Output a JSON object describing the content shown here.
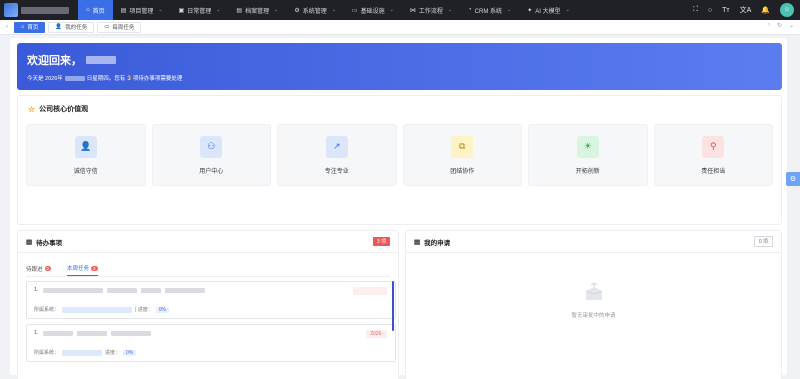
{
  "nav": {
    "items": [
      {
        "label": "首页",
        "icon": "⌂",
        "active": true,
        "has_menu": false
      },
      {
        "label": "项目管理",
        "icon": "▤",
        "active": false,
        "has_menu": true
      },
      {
        "label": "日常管理",
        "icon": "▣",
        "active": false,
        "has_menu": true
      },
      {
        "label": "档案管理",
        "icon": "▤",
        "active": false,
        "has_menu": true
      },
      {
        "label": "系统管理",
        "icon": "⚙",
        "active": false,
        "has_menu": true
      },
      {
        "label": "基础设施",
        "icon": "▭",
        "active": false,
        "has_menu": true
      },
      {
        "label": "工作流程",
        "icon": "⋈",
        "active": false,
        "has_menu": true
      },
      {
        "label": "CRM 系统",
        "icon": "◔",
        "active": false,
        "has_menu": true
      },
      {
        "label": "AI 大模型",
        "icon": "✦",
        "active": false,
        "has_menu": true
      }
    ],
    "right_icons": [
      "⛶",
      "○",
      "Tт",
      "文A",
      "🔔"
    ],
    "chevron": "⌄"
  },
  "tabs": [
    {
      "label": "首页",
      "icon": "⌂",
      "active": true
    },
    {
      "label": "我的任务",
      "icon": "👤",
      "active": false
    },
    {
      "label": "每周任务",
      "icon": "▭",
      "active": false
    }
  ],
  "banner": {
    "greeting": "欢迎回来，",
    "text_prefix": "今天是 2026年",
    "text_mid": "日星期四。您有",
    "pending_count": "3",
    "text_suffix": "项待办事项需要处理"
  },
  "values_section": {
    "title": "公司核心价值观",
    "cards": [
      {
        "label": "诚信守信",
        "icon": "👤",
        "bg": "#dbe6fb",
        "fg": "#3b6fe8"
      },
      {
        "label": "用户中心",
        "icon": "⚇",
        "bg": "#dbe6fb",
        "fg": "#3b6fe8"
      },
      {
        "label": "专注专业",
        "icon": "↗",
        "bg": "#dbe6fb",
        "fg": "#3b6fe8"
      },
      {
        "label": "团结协作",
        "icon": "⧉",
        "bg": "#fdf3c7",
        "fg": "#b38a00"
      },
      {
        "label": "开拓创新",
        "icon": "☀",
        "bg": "#d8f5df",
        "fg": "#2ea44f"
      },
      {
        "label": "责任担当",
        "icon": "⚲",
        "bg": "#fde2e2",
        "fg": "#d9534f"
      }
    ]
  },
  "todo": {
    "title": "待办事项",
    "badge": "3 项",
    "subtabs": [
      {
        "label": "待跟进",
        "count": "0",
        "active": false
      },
      {
        "label": "本周任务",
        "count": "3",
        "active": true
      }
    ],
    "tasks": [
      {
        "index": "1.",
        "date": "",
        "system_label": "所属系统：",
        "progress_label": "| 进度：",
        "progress": "0%"
      },
      {
        "index": "1.",
        "date": "2026-",
        "system_label": "所属系统：",
        "progress_label": "进度：",
        "progress": "0%"
      }
    ]
  },
  "applications": {
    "title": "我的申请",
    "badge": "0 项",
    "empty_text": "暂无审批中的申请"
  },
  "colors": {
    "accent": "#3b6fe8",
    "nav_bg": "#1f2127",
    "danger": "#e85a5a"
  }
}
